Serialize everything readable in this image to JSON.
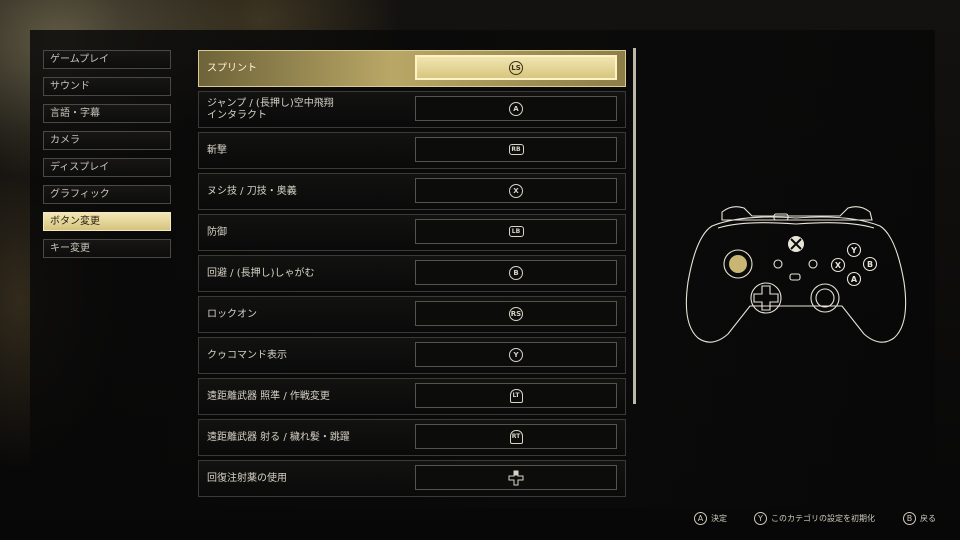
{
  "sidebar": {
    "items": [
      {
        "label": "ゲームプレイ"
      },
      {
        "label": "サウンド"
      },
      {
        "label": "言語・字幕"
      },
      {
        "label": "カメラ"
      },
      {
        "label": "ディスプレイ"
      },
      {
        "label": "グラフィック"
      },
      {
        "label": "ボタン変更"
      },
      {
        "label": "キー変更"
      }
    ],
    "selected": "ボタン変更"
  },
  "bindings": [
    {
      "action": "スプリント",
      "button": "LS",
      "icon": "left-stick-click-icon",
      "selected": true
    },
    {
      "action": "ジャンプ / (長押し)空中飛翔\nインタラクト",
      "button": "A",
      "icon": "a-button-icon"
    },
    {
      "action": "斬撃",
      "button": "RB",
      "icon": "rb-bumper-icon"
    },
    {
      "action": "ヌシ技 / 刀技・奥義",
      "button": "X",
      "icon": "x-button-icon"
    },
    {
      "action": "防御",
      "button": "LB",
      "icon": "lb-bumper-icon"
    },
    {
      "action": "回避 / (長押し)しゃがむ",
      "button": "B",
      "icon": "b-button-icon"
    },
    {
      "action": "ロックオン",
      "button": "RS",
      "icon": "right-stick-click-icon"
    },
    {
      "action": "クゥコマンド表示",
      "button": "Y",
      "icon": "y-button-icon"
    },
    {
      "action": "遠距離武器 照準 / 作戦変更",
      "button": "LT",
      "icon": "lt-trigger-icon"
    },
    {
      "action": "遠距離武器 射る / 穢れ髪・跳躍",
      "button": "RT",
      "icon": "rt-trigger-icon"
    },
    {
      "action": "回復注射薬の使用",
      "button": "",
      "icon": "dpad-up-icon"
    }
  ],
  "footer": {
    "confirm": {
      "button": "A",
      "label": "決定"
    },
    "reset": {
      "button": "Y",
      "label": "このカテゴリの設定を初期化"
    },
    "back": {
      "button": "B",
      "label": "戻る"
    }
  },
  "colors": {
    "accent": "#d8c67f",
    "highlight_border": "#fff3c6"
  }
}
